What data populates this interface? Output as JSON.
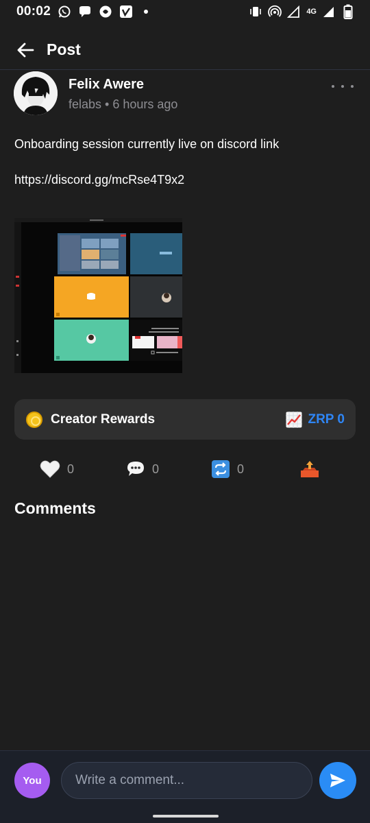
{
  "status_bar": {
    "time": "00:02",
    "network": "4G",
    "icons": [
      "whatsapp-icon",
      "chat-bubble-icon",
      "app-icon",
      "vimeo-icon",
      "vibrate-icon",
      "hotspot-icon",
      "signal-icon",
      "battery-icon"
    ]
  },
  "app_bar": {
    "title": "Post"
  },
  "post": {
    "author_name": "Felix Awere",
    "author_meta": "felabs • 6 hours ago",
    "text_line1": "Onboarding session currently live on discord link",
    "text_line2": "https://discord.gg/mcRse4T9x2"
  },
  "rewards": {
    "label": "Creator Rewards",
    "value": "ZRP 0"
  },
  "actions": {
    "likes": "0",
    "comments": "0",
    "reposts": "0"
  },
  "comments_section": {
    "title": "Comments"
  },
  "composer": {
    "avatar_label": "You",
    "placeholder": "Write a comment..."
  },
  "colors": {
    "background": "#1e1e1e",
    "accent_blue": "#2f86f6",
    "avatar_purple": "#a55cf0",
    "card": "#2f2f2f"
  }
}
